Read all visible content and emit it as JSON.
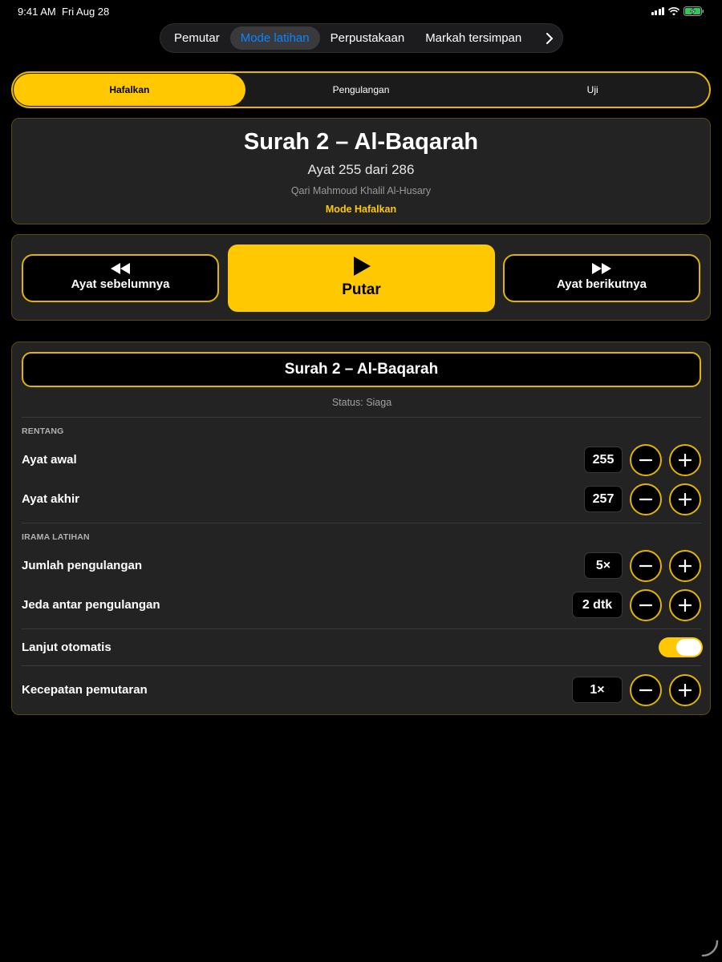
{
  "status_bar": {
    "time": "9:41 AM",
    "date": "Fri Aug 28"
  },
  "top_nav": {
    "tabs": [
      "Pemutar",
      "Mode latihan",
      "Perpustakaan",
      "Markah tersimpan"
    ],
    "active": "Mode latihan"
  },
  "segments": {
    "items": [
      "Hafalkan",
      "Pengulangan",
      "Uji"
    ],
    "active": "Hafalkan"
  },
  "info": {
    "title": "Surah 2 – Al-Baqarah",
    "ayat": "Ayat 255 dari 286",
    "qari": "Qari Mahmoud Khalil Al-Husary",
    "mode": "Mode Hafalkan"
  },
  "controls": {
    "prev": "Ayat sebelumnya",
    "play": "Putar",
    "next": "Ayat berikutnya"
  },
  "settings": {
    "surah": "Surah 2 – Al-Baqarah",
    "status": "Status: Siaga",
    "range_header": "RENTANG",
    "start_label": "Ayat awal",
    "start_value": "255",
    "end_label": "Ayat akhir",
    "end_value": "257",
    "rhythm_header": "IRAMA LATIHAN",
    "repeat_label": "Jumlah pengulangan",
    "repeat_value": "5×",
    "pause_label": "Jeda antar pengulangan",
    "pause_value": "2 dtk",
    "auto_label": "Lanjut otomatis",
    "auto_on": true,
    "speed_label": "Kecepatan pemutaran",
    "speed_value": "1×"
  },
  "colors": {
    "accent": "#ffc800",
    "link": "#0a84ff",
    "card": "#232323"
  }
}
